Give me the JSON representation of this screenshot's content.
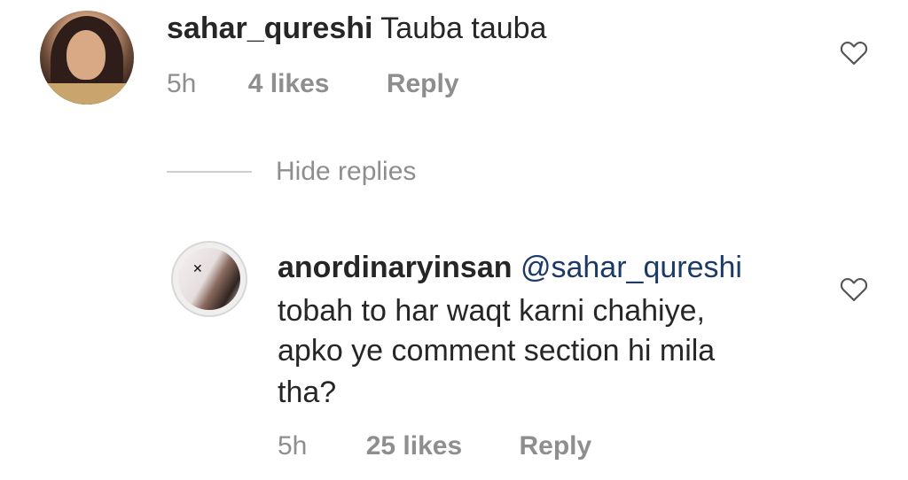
{
  "comment": {
    "username": "sahar_qureshi",
    "text": "Tauba tauba",
    "time": "5h",
    "likes": "4 likes",
    "reply_label": "Reply",
    "avatar_icon": "profile-photo",
    "like_icon": "heart-outline-icon"
  },
  "replies_toggle": {
    "label": "Hide replies"
  },
  "reply": {
    "username": "anordinaryinsan",
    "mention": "@sahar_qureshi",
    "text_lines": [
      "tobah to har waqt karni chahiye,",
      "apko ye comment section hi mila",
      "tha?"
    ],
    "time": "5h",
    "likes": "25 likes",
    "reply_label": "Reply",
    "avatar_icon": "profile-photo",
    "like_icon": "heart-outline-icon"
  },
  "colors": {
    "text": "#262626",
    "meta": "#8e8e8e",
    "mention": "#1b3a66",
    "background": "#ffffff"
  }
}
